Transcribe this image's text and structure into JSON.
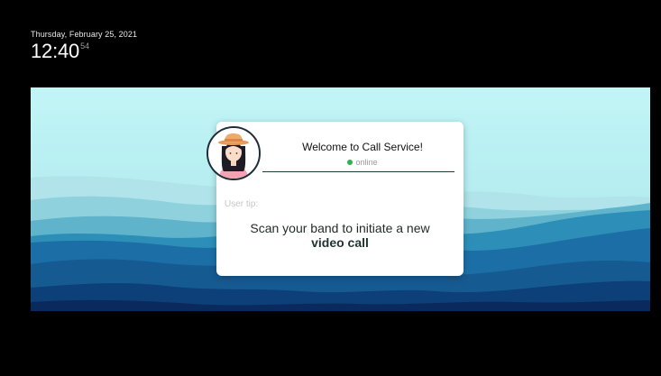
{
  "clock": {
    "date": "Thursday, February 25, 2021",
    "time": "12:40",
    "seconds": "54"
  },
  "card": {
    "title": "Welcome to Call Service!",
    "status": "online",
    "tip_label": "User tip:",
    "tip_text": "Scan your band to initiate a new",
    "tip_emphasis": "video call"
  },
  "colors": {
    "status_online": "#2db34a",
    "sky": "#bdf3f3",
    "mountain_dark": "#0a2a5e"
  },
  "icons": {
    "avatar": "female-avatar-icon",
    "status": "status-dot-icon"
  }
}
